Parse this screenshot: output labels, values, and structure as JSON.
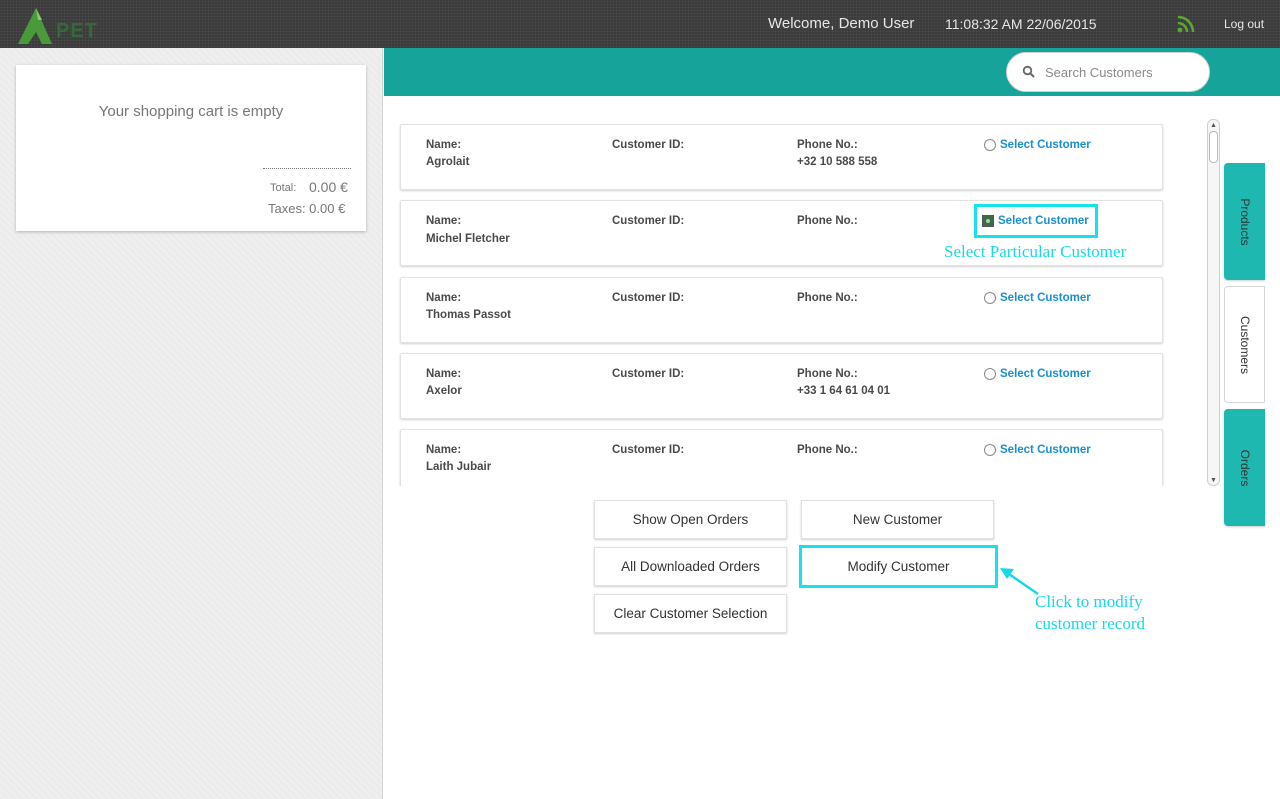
{
  "header": {
    "logo_text": "PET",
    "welcome": "Welcome, Demo User",
    "datetime": "11:08:32 AM 22/06/2015",
    "logout": "Log out",
    "rss_icon": "rss-icon"
  },
  "cart": {
    "empty_message": "Your shopping cart is empty",
    "total_label": "Total:",
    "total_value": "0.00 €",
    "taxes": "Taxes: 0.00 €"
  },
  "search": {
    "placeholder": "Search Customers",
    "value": ""
  },
  "customer_labels": {
    "name": "Name:",
    "customer_id": "Customer ID:",
    "phone": "Phone No.:",
    "select": "Select Customer"
  },
  "customers": [
    {
      "name": "Agrolait",
      "customer_id": "",
      "phone": "+32 10 588 558",
      "selected": false
    },
    {
      "name": "Michel Fletcher",
      "customer_id": "",
      "phone": "",
      "selected": true
    },
    {
      "name": "Thomas Passot",
      "customer_id": "",
      "phone": "",
      "selected": false
    },
    {
      "name": "Axelor",
      "customer_id": "",
      "phone": "+33 1 64 61 04 01",
      "selected": false
    },
    {
      "name": "Laith Jubair",
      "customer_id": "",
      "phone": "",
      "selected": false
    }
  ],
  "side_tabs": [
    {
      "label": "Products",
      "active": false
    },
    {
      "label": "Customers",
      "active": true
    },
    {
      "label": "Orders",
      "active": false
    }
  ],
  "buttons": {
    "show_open_orders": "Show Open Orders",
    "new_customer": "New Customer",
    "all_downloaded_orders": "All Downloaded Orders",
    "modify_customer": "Modify Customer",
    "clear_customer_selection": "Clear Customer Selection"
  },
  "annotations": {
    "select_note": "Select Particular Customer",
    "click_note_line1": "Click to modify",
    "click_note_line2": "customer record"
  },
  "colors": {
    "teal": "#16a39a",
    "highlight": "#17e1ee",
    "link": "#1a8fd0"
  }
}
